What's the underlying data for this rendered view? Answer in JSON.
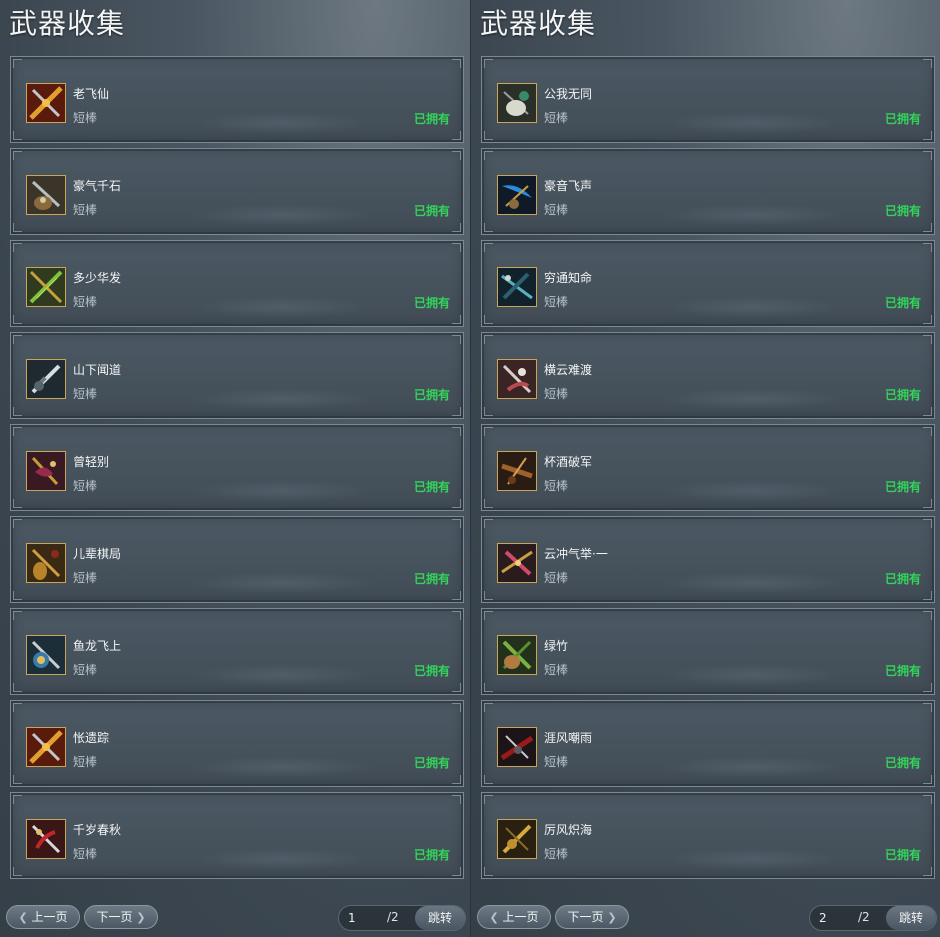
{
  "panels": [
    {
      "title": "武器收集",
      "page_current": "1",
      "page_total": "/2",
      "prev_label": "上一页",
      "next_label": "下一页",
      "jump_label": "跳转",
      "items": [
        {
          "name": "老飞仙",
          "type": "短棒",
          "status": "已拥有",
          "icon": "crossed-sword-gold-icon"
        },
        {
          "name": "豪气千石",
          "type": "短棒",
          "status": "已拥有",
          "icon": "sword-gourd-icon"
        },
        {
          "name": "多少华发",
          "type": "短棒",
          "status": "已拥有",
          "icon": "crossed-green-blades-icon"
        },
        {
          "name": "山下闻道",
          "type": "短棒",
          "status": "已拥有",
          "icon": "silver-sword-icon"
        },
        {
          "name": "曾轻别",
          "type": "短棒",
          "status": "已拥有",
          "icon": "red-axe-icon"
        },
        {
          "name": "儿辈棋局",
          "type": "短棒",
          "status": "已拥有",
          "icon": "sword-vase-icon"
        },
        {
          "name": "鱼龙飞上",
          "type": "短棒",
          "status": "已拥有",
          "icon": "dragon-sword-icon"
        },
        {
          "name": "怅遗踪",
          "type": "短棒",
          "status": "已拥有",
          "icon": "crossed-sword-gold-icon"
        },
        {
          "name": "千岁春秋",
          "type": "短棒",
          "status": "已拥有",
          "icon": "red-ribbon-sword-icon"
        }
      ]
    },
    {
      "title": "武器收集",
      "page_current": "2",
      "page_total": "/2",
      "prev_label": "上一页",
      "next_label": "下一页",
      "jump_label": "跳转",
      "items": [
        {
          "name": "公我无同",
          "type": "短棒",
          "status": "已拥有",
          "icon": "jade-gourd-icon"
        },
        {
          "name": "豪音飞声",
          "type": "短棒",
          "status": "已拥有",
          "icon": "blue-blade-icon"
        },
        {
          "name": "穷通知命",
          "type": "短棒",
          "status": "已拥有",
          "icon": "teal-spear-icon"
        },
        {
          "name": "横云难渡",
          "type": "短棒",
          "status": "已拥有",
          "icon": "ribbon-sword-icon"
        },
        {
          "name": "杯酒破军",
          "type": "短棒",
          "status": "已拥有",
          "icon": "bronze-blade-icon"
        },
        {
          "name": "云冲气举·一",
          "type": "短棒",
          "status": "已拥有",
          "icon": "pink-crossed-icon"
        },
        {
          "name": "绿竹",
          "type": "短棒",
          "status": "已拥有",
          "icon": "bamboo-gourd-icon"
        },
        {
          "name": "涯风嘲雨",
          "type": "短棒",
          "status": "已拥有",
          "icon": "dark-red-blade-icon"
        },
        {
          "name": "厉风炽海",
          "type": "短棒",
          "status": "已拥有",
          "icon": "gold-dagger-icon"
        }
      ]
    }
  ],
  "colors": {
    "owned_text": "#33d35a",
    "card_border": "#7c8893",
    "icon_border": "#c9a55a"
  }
}
